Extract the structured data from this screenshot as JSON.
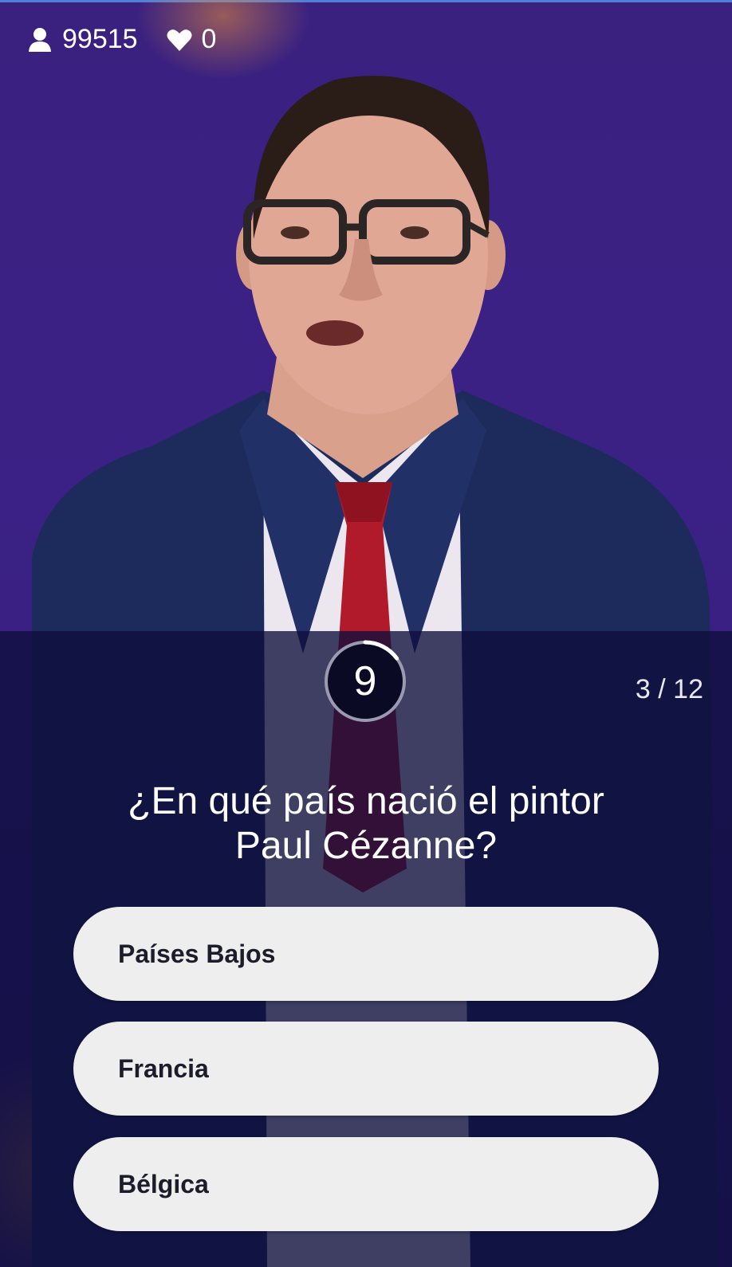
{
  "stats": {
    "players": "99515",
    "lives": "0"
  },
  "timer": {
    "seconds": "9",
    "remaining_fraction": 0.15
  },
  "progress": "3 / 12",
  "question": {
    "line1": "¿En qué país nació el pintor",
    "line2": "Paul Cézanne?"
  },
  "answers": [
    {
      "label": "Países Bajos"
    },
    {
      "label": "Francia"
    },
    {
      "label": "Bélgica"
    }
  ],
  "icons": {
    "players": "person-icon",
    "lives": "heart-icon"
  },
  "colors": {
    "background": "#3b2185",
    "panel": "#0e0e3c",
    "answer_bg": "#eeeeee",
    "answer_text": "#1c1c2a"
  }
}
